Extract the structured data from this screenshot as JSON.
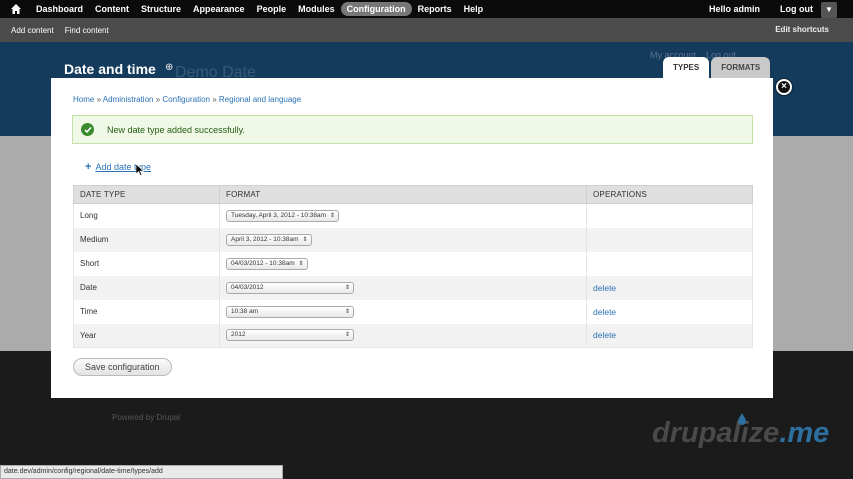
{
  "toolbar": {
    "menu": [
      "Dashboard",
      "Content",
      "Structure",
      "Appearance",
      "People",
      "Modules",
      "Configuration",
      "Reports",
      "Help"
    ],
    "active": "Configuration",
    "greeting": "Hello admin",
    "logout": "Log out"
  },
  "shortcuts": {
    "items": [
      "Add content",
      "Find content"
    ],
    "edit": "Edit shortcuts"
  },
  "page": {
    "title": "Date and time",
    "site_name": "Demo Date",
    "my_account": "My account",
    "log_out": "Log out",
    "powered": "Powered by Drupal"
  },
  "tabs": [
    {
      "label": "TYPES",
      "active": true
    },
    {
      "label": "FORMATS",
      "active": false
    }
  ],
  "overlay": {
    "breadcrumb": [
      "Home",
      "Administration",
      "Configuration",
      "Regional and language"
    ],
    "message": "New date type added successfully.",
    "add_link": "Add date type",
    "table": {
      "headers": [
        "DATE TYPE",
        "FORMAT",
        "OPERATIONS"
      ],
      "rows": [
        {
          "type": "Long",
          "format": "Tuesday, April 3, 2012 - 10:38am",
          "op": ""
        },
        {
          "type": "Medium",
          "format": "April 3, 2012 - 10:38am",
          "op": ""
        },
        {
          "type": "Short",
          "format": "04/03/2012 - 10:38am",
          "op": ""
        },
        {
          "type": "Date",
          "format": "04/03/2012",
          "op": "delete"
        },
        {
          "type": "Time",
          "format": "10:38 am",
          "op": "delete"
        },
        {
          "type": "Year",
          "format": "2012",
          "op": "delete"
        }
      ]
    },
    "save": "Save configuration"
  },
  "brand": {
    "main": "drupalize",
    "suffix": ".me"
  },
  "statusbar": "date.dev/admin/config/regional/date-time/types/add",
  "colors": {
    "link": "#2a72b5",
    "header_bg": "#143b5c",
    "success": "#3a8b2e"
  }
}
